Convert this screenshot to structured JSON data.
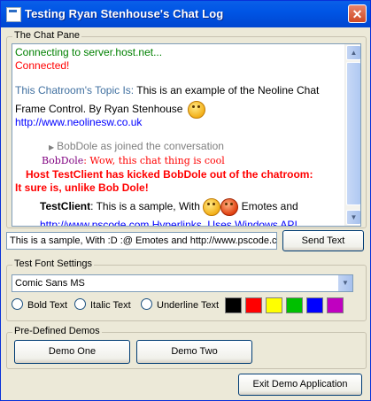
{
  "window": {
    "title": "Testing Ryan Stenhouse's Chat Log",
    "close_glyph": "✕"
  },
  "chat_pane": {
    "label": "The Chat Pane",
    "lines": {
      "connecting": "Connecting to server.host.net...",
      "connected": "Connected!",
      "topic_label": "This Chatroom's Topic Is:",
      "topic_text": "This is an example of the Neoline Chat",
      "topic_text2": "Frame Control. By Ryan Stenhouse",
      "link": "http://www.neolinesw.co.uk",
      "join_notice": "BobDole as joined the conversation",
      "bob_name": "BobDole",
      "bob_msg": ": Wow, this chat thing is cool",
      "kick_msg": "Host TestClient has kicked BobDole out of the chatroom:",
      "kick_reason": "It sure is, unlike Bob Dole!",
      "test_name": "TestClient",
      "test_msg": ": This is a sample, With",
      "test_msg_end": "Emotes and",
      "partial_line": "http://www.pscode.com Hyperlinks, Uses Windows API"
    },
    "emote_icons": [
      "smiley-icon",
      "smiley-icon",
      "angry-smiley-icon"
    ]
  },
  "message_input": {
    "value": "This is a sample, With :D :@ Emotes and http://www.pscode.co"
  },
  "send_button": "Send Text",
  "font_settings": {
    "label": "Test Font Settings",
    "font_selected": "Comic Sans MS",
    "bold_label": "Bold Text",
    "italic_label": "Italic Text",
    "underline_label": "Underline Text",
    "colors": [
      "#000000",
      "#FF0000",
      "#FFFF00",
      "#00C000",
      "#0000FF",
      "#C000C0"
    ]
  },
  "demos": {
    "label": "Pre-Defined Demos",
    "demo_one": "Demo One",
    "demo_two": "Demo Two"
  },
  "exit_button": "Exit Demo Application"
}
